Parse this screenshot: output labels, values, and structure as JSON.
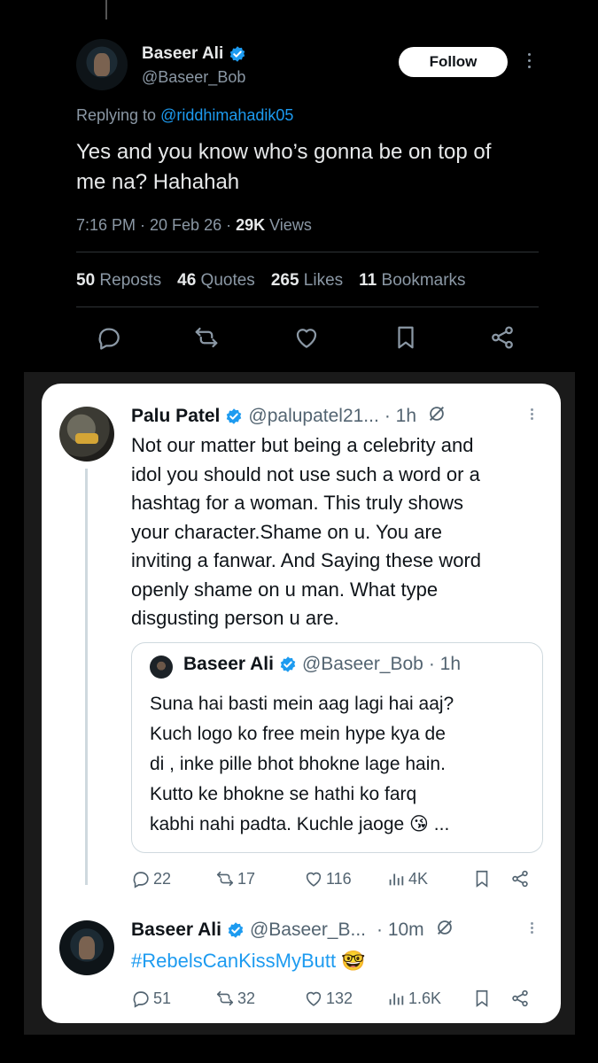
{
  "main_tweet": {
    "author_name": "Baseer Ali",
    "handle": "@Baseer_Bob",
    "follow_label": "Follow",
    "replying_prefix": "Replying to ",
    "replying_handle": "@riddhimahadik05",
    "text_line1": "Yes and you know who’s gonna be on top of",
    "text_line2": "me na? Hahahah",
    "time": "7:16 PM · 20 Feb 26 · ",
    "views_count": "29K",
    "views_label": " Views",
    "stats": {
      "reposts_count": "50",
      "reposts_label": "Reposts",
      "quotes_count": "46",
      "quotes_label": "Quotes",
      "likes_count": "265",
      "likes_label": "Likes",
      "bookmarks_count": "11",
      "bookmarks_label": "Bookmarks"
    }
  },
  "screenshot_card": {
    "reply": {
      "name": "Palu Patel",
      "handle": "@palupatel21...",
      "time": "· 1h",
      "lines": [
        "Not our matter but being a celebrity and",
        "idol you should not use such a word or a",
        "hashtag for a woman. This truly shows",
        "your character.Shame on u. You are",
        "inviting a fanwar. And Saying these word",
        "openly shame on u man. What type",
        "disgusting person u are."
      ],
      "quote": {
        "name": "Baseer Ali",
        "handle": "@Baseer_Bob",
        "time": "· 1h",
        "lines": [
          "Suna hai basti mein aag lagi hai aaj?",
          "Kuch logo ko free mein hype kya de",
          "di , inke pille bhot bhokne lage hain.",
          "Kutto ke bhokne se hathi ko farq",
          "kabhi nahi padta. Kuchle jaoge 😘 ..."
        ]
      },
      "actions": {
        "replies": "22",
        "reposts": "17",
        "likes": "116",
        "views": "4K"
      }
    },
    "second": {
      "name": "Baseer Ali",
      "handle": "@Baseer_B...",
      "time": "· 10m",
      "text": "#RebelsCanKissMyButt 🤓",
      "actions": {
        "replies": "51",
        "reposts": "32",
        "likes": "132",
        "views": "1.6K"
      }
    }
  },
  "colors": {
    "accent": "#1d9bf0",
    "background": "#000000",
    "card": "#ffffff"
  },
  "icons": [
    "verified-badge-icon",
    "more-dots-icon",
    "reply-icon",
    "repost-icon",
    "like-icon",
    "bookmark-icon",
    "share-icon",
    "grok-icon",
    "views-icon"
  ]
}
